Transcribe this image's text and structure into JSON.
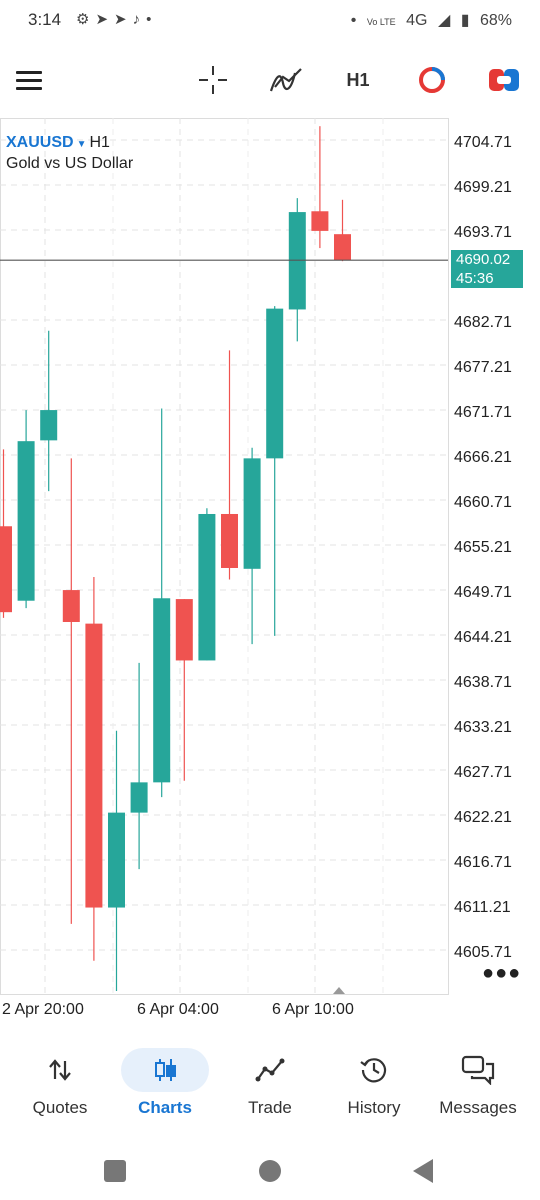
{
  "status_bar": {
    "time": "3:14",
    "left_icons": [
      "settings-icon",
      "telegram-icon",
      "telegram-icon",
      "tiktok-icon",
      "dot-icon"
    ],
    "network": "4G",
    "volte": "Vo LTE",
    "battery": "68%"
  },
  "toolbar": {
    "timeframe": "H1",
    "icons": [
      "menu-icon",
      "crosshair-icon",
      "indicators-icon",
      "one-click-trading-icon",
      "trade-toggle-icon"
    ]
  },
  "chart": {
    "symbol": "XAUUSD",
    "timeframe": "H1",
    "description": "Gold vs US Dollar",
    "price_tag": "4690.02",
    "countdown": "45:36",
    "y_ticks": [
      "4704.71",
      "4699.21",
      "4693.71",
      "4682.71",
      "4677.21",
      "4671.71",
      "4666.21",
      "4660.71",
      "4655.21",
      "4649.71",
      "4644.21",
      "4638.71",
      "4633.21",
      "4627.71",
      "4622.21",
      "4616.71",
      "4611.21",
      "4605.71"
    ],
    "x_ticks": [
      "2 Apr 20:00",
      "6 Apr 04:00",
      "6 Apr 10:00"
    ]
  },
  "chart_data": {
    "type": "candlestick",
    "title": "XAUUSD, H1",
    "subtitle": "Gold vs US Dollar",
    "ylim": [
      4602.5,
      4707.2
    ],
    "current_price": 4690.02,
    "up_color": "#26a69a",
    "down_color": "#ef5350",
    "candles": [
      {
        "o": 4657.5,
        "h": 4666.9,
        "l": 4646.3,
        "c": 4647.0
      },
      {
        "o": 4648.4,
        "h": 4671.7,
        "l": 4647.5,
        "c": 4667.9
      },
      {
        "o": 4668.0,
        "h": 4681.4,
        "l": 4661.8,
        "c": 4671.7
      },
      {
        "o": 4649.7,
        "h": 4665.8,
        "l": 4608.9,
        "c": 4645.8
      },
      {
        "o": 4645.6,
        "h": 4651.3,
        "l": 4604.4,
        "c": 4610.9
      },
      {
        "o": 4610.9,
        "h": 4632.5,
        "l": 4600.7,
        "c": 4622.5
      },
      {
        "o": 4622.5,
        "h": 4640.8,
        "l": 4615.6,
        "c": 4626.2
      },
      {
        "o": 4626.2,
        "h": 4671.9,
        "l": 4624.4,
        "c": 4648.7
      },
      {
        "o": 4648.6,
        "h": 4648.6,
        "l": 4626.4,
        "c": 4641.1
      },
      {
        "o": 4641.1,
        "h": 4659.7,
        "l": 4641.1,
        "c": 4659.0
      },
      {
        "o": 4659.0,
        "h": 4679.0,
        "l": 4651.0,
        "c": 4652.4
      },
      {
        "o": 4652.3,
        "h": 4667.1,
        "l": 4643.1,
        "c": 4665.8
      },
      {
        "o": 4665.8,
        "h": 4684.4,
        "l": 4644.1,
        "c": 4684.1
      },
      {
        "o": 4684.0,
        "h": 4697.6,
        "l": 4680.1,
        "c": 4695.9
      },
      {
        "o": 4696.0,
        "h": 4706.4,
        "l": 4691.5,
        "c": 4693.6
      },
      {
        "o": 4693.2,
        "h": 4697.4,
        "l": 4689.9,
        "c": 4690.0
      }
    ]
  },
  "nav": {
    "items": [
      {
        "label": "Quotes",
        "icon": "quotes-arrows-icon"
      },
      {
        "label": "Charts",
        "icon": "charts-candles-icon"
      },
      {
        "label": "Trade",
        "icon": "trade-line-icon"
      },
      {
        "label": "History",
        "icon": "history-clock-icon"
      },
      {
        "label": "Messages",
        "icon": "messages-bubbles-icon"
      }
    ],
    "active": "Charts"
  }
}
